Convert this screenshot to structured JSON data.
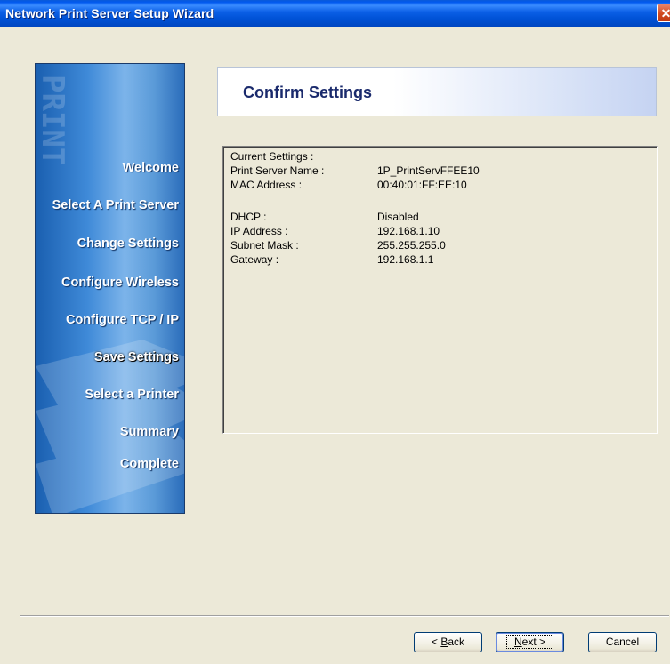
{
  "window": {
    "title": "Network Print Server Setup Wizard",
    "close_glyph": "✕"
  },
  "sidebar": {
    "watermark": "PRINT",
    "items": [
      {
        "label": "Welcome",
        "active": false
      },
      {
        "label": "Select A Print Server",
        "active": false
      },
      {
        "label": "Change Settings",
        "active": false
      },
      {
        "label": "Configure Wireless",
        "active": false
      },
      {
        "label": "Configure TCP / IP",
        "active": false
      },
      {
        "label": "Save Settings",
        "active": true
      },
      {
        "label": "Select a Printer",
        "active": false
      },
      {
        "label": "Summary",
        "active": false
      },
      {
        "label": "Complete",
        "active": false
      }
    ]
  },
  "header": {
    "title": "Confirm Settings"
  },
  "settings": {
    "heading": "Current Settings :",
    "rows": [
      {
        "label": "Print Server Name :",
        "value": "1P_PrintServFFEE10"
      },
      {
        "label": "MAC Address :",
        "value": "00:40:01:FF:EE:10"
      },
      {
        "label": "DHCP :",
        "value": "Disabled"
      },
      {
        "label": "IP Address :",
        "value": "192.168.1.10"
      },
      {
        "label": "Subnet Mask :",
        "value": "255.255.255.0"
      },
      {
        "label": "Gateway :",
        "value": "192.168.1.1"
      }
    ]
  },
  "buttons": {
    "back_prefix": "< ",
    "back_accel": "B",
    "back_rest": "ack",
    "next_accel": "N",
    "next_rest": "ext >",
    "cancel": "Cancel"
  },
  "colors": {
    "titlebar": "#0052d6",
    "sidebar": "#3f8ad8",
    "header_text": "#1a2a6c",
    "dialog_bg": "#ece9d8"
  }
}
